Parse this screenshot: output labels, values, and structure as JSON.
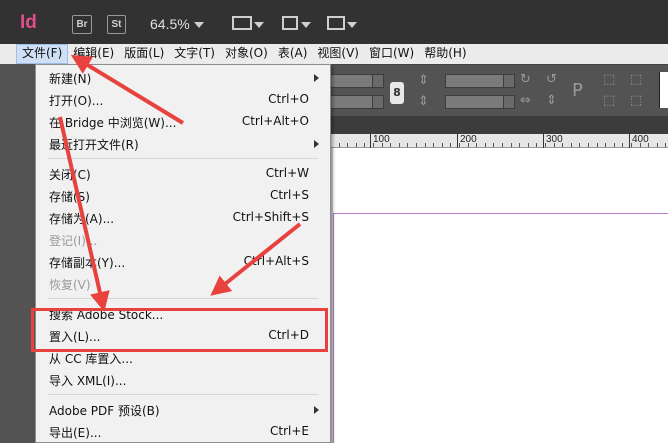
{
  "titlebar": {
    "app_logo": "Id",
    "bridge_label": "Br",
    "stock_label": "St",
    "zoom_level": "64.5%"
  },
  "menubar": {
    "items": [
      {
        "label": "文件(F)"
      },
      {
        "label": "编辑(E)"
      },
      {
        "label": "版面(L)"
      },
      {
        "label": "文字(T)"
      },
      {
        "label": "对象(O)"
      },
      {
        "label": "表(A)"
      },
      {
        "label": "视图(V)"
      },
      {
        "label": "窗口(W)"
      },
      {
        "label": "帮助(H)"
      }
    ]
  },
  "ruler": {
    "labels": [
      "100",
      "200",
      "300",
      "400"
    ]
  },
  "file_menu": {
    "items": [
      {
        "label": "新建(N)",
        "shortcut": ""
      },
      {
        "label": "打开(O)...",
        "shortcut": "Ctrl+O"
      },
      {
        "label": "在 Bridge 中浏览(W)...",
        "shortcut": "Ctrl+Alt+O"
      },
      {
        "label": "最近打开文件(R)",
        "shortcut": ""
      },
      {
        "label": "关闭(C)",
        "shortcut": "Ctrl+W"
      },
      {
        "label": "存储(S)",
        "shortcut": "Ctrl+S"
      },
      {
        "label": "存储为(A)...",
        "shortcut": "Ctrl+Shift+S"
      },
      {
        "label": "登记(I)...",
        "shortcut": ""
      },
      {
        "label": "存储副本(Y)...",
        "shortcut": "Ctrl+Alt+S"
      },
      {
        "label": "恢复(V)",
        "shortcut": ""
      },
      {
        "label": "搜索 Adobe Stock...",
        "shortcut": ""
      },
      {
        "label": "置入(L)...",
        "shortcut": "Ctrl+D"
      },
      {
        "label": "从 CC 库置入...",
        "shortcut": ""
      },
      {
        "label": "导入 XML(I)...",
        "shortcut": ""
      },
      {
        "label": "Adobe PDF 预设(B)",
        "shortcut": ""
      },
      {
        "label": "导出(E)...",
        "shortcut": "Ctrl+E"
      }
    ]
  },
  "colors": {
    "annotation": "#e8423f",
    "app_accent": "#e04d8b"
  }
}
